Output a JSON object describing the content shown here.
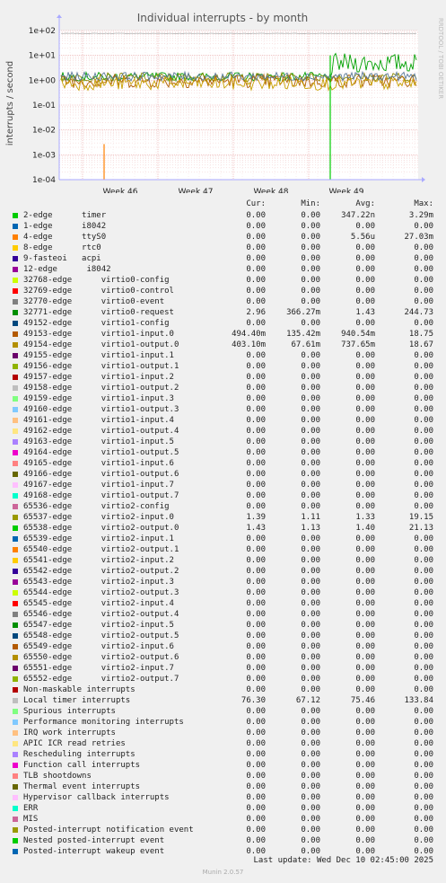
{
  "chart_data": {
    "type": "line",
    "title": "Individual interrupts - by month",
    "ylabel": "interrupts / second",
    "side_label": "RRDTOOL / TOBI OETIKER",
    "yscale": "log",
    "ylim": [
      0.0001,
      100
    ],
    "y_ticks": [
      "1e+02",
      "1e+01",
      "1e+00",
      "1e-01",
      "1e-02",
      "1e-03",
      "1e-04"
    ],
    "x_ticks": [
      "Week 46",
      "Week 47",
      "Week 48",
      "Week 49"
    ],
    "grid": true,
    "series": [
      {
        "name": "Local timer interrupts",
        "color": "#b8b8b8",
        "level": 76.3
      },
      {
        "name": "65538-edge virtio2-output.0",
        "color": "#00a000",
        "level": 1.4
      },
      {
        "name": "65537-edge virtio2-input.0",
        "color": "#8a8a00",
        "level": 1.33
      },
      {
        "name": "49153-edge virtio1-input.0",
        "color": "#b06000",
        "level": 0.94
      },
      {
        "name": "49154-edge virtio1-output.0",
        "color": "#c8a000",
        "level": 0.74
      },
      {
        "name": "32771-edge virtio0-request",
        "color": "#5a7a9a",
        "level": 1.43
      }
    ],
    "spikes": [
      {
        "series": "4-edge ttyS0",
        "x": "Week 46",
        "value": 0.0027
      },
      {
        "series": "65538-edge virtio2-output.0",
        "x": "Week 49",
        "value": 10
      }
    ]
  },
  "legend": {
    "headers": {
      "cur": "Cur:",
      "min": "Min:",
      "avg": "Avg:",
      "max": "Max:"
    },
    "rows": [
      {
        "color": "#00cc00",
        "label": "2-edge      timer",
        "cur": "0.00",
        "min": "0.00",
        "avg": "347.22n",
        "max": "3.29m"
      },
      {
        "color": "#0066b3",
        "label": "1-edge      i8042",
        "cur": "0.00",
        "min": "0.00",
        "avg": "0.00",
        "max": "0.00"
      },
      {
        "color": "#ff8000",
        "label": "4-edge      ttyS0",
        "cur": "0.00",
        "min": "0.00",
        "avg": "5.56u",
        "max": "27.03m"
      },
      {
        "color": "#ffcc00",
        "label": "8-edge      rtc0",
        "cur": "0.00",
        "min": "0.00",
        "avg": "0.00",
        "max": "0.00"
      },
      {
        "color": "#330099",
        "label": "9-fasteoi   acpi",
        "cur": "0.00",
        "min": "0.00",
        "avg": "0.00",
        "max": "0.00"
      },
      {
        "color": "#990099",
        "label": "12-edge      i8042",
        "cur": "0.00",
        "min": "0.00",
        "avg": "0.00",
        "max": "0.00"
      },
      {
        "color": "#ccff00",
        "label": "32768-edge      virtio0-config",
        "cur": "0.00",
        "min": "0.00",
        "avg": "0.00",
        "max": "0.00"
      },
      {
        "color": "#ff0000",
        "label": "32769-edge      virtio0-control",
        "cur": "0.00",
        "min": "0.00",
        "avg": "0.00",
        "max": "0.00"
      },
      {
        "color": "#808080",
        "label": "32770-edge      virtio0-event",
        "cur": "0.00",
        "min": "0.00",
        "avg": "0.00",
        "max": "0.00"
      },
      {
        "color": "#008f00",
        "label": "32771-edge      virtio0-request",
        "cur": "2.96",
        "min": "366.27m",
        "avg": "1.43",
        "max": "244.73"
      },
      {
        "color": "#00487d",
        "label": "49152-edge      virtio1-config",
        "cur": "0.00",
        "min": "0.00",
        "avg": "0.00",
        "max": "0.00"
      },
      {
        "color": "#b35a00",
        "label": "49153-edge      virtio1-input.0",
        "cur": "494.40m",
        "min": "135.42m",
        "avg": "940.54m",
        "max": "18.75"
      },
      {
        "color": "#b38f00",
        "label": "49154-edge      virtio1-output.0",
        "cur": "403.10m",
        "min": "67.61m",
        "avg": "737.65m",
        "max": "18.67"
      },
      {
        "color": "#6b006b",
        "label": "49155-edge      virtio1-input.1",
        "cur": "0.00",
        "min": "0.00",
        "avg": "0.00",
        "max": "0.00"
      },
      {
        "color": "#8fb300",
        "label": "49156-edge      virtio1-output.1",
        "cur": "0.00",
        "min": "0.00",
        "avg": "0.00",
        "max": "0.00"
      },
      {
        "color": "#b30000",
        "label": "49157-edge      virtio1-input.2",
        "cur": "0.00",
        "min": "0.00",
        "avg": "0.00",
        "max": "0.00"
      },
      {
        "color": "#bebebe",
        "label": "49158-edge      virtio1-output.2",
        "cur": "0.00",
        "min": "0.00",
        "avg": "0.00",
        "max": "0.00"
      },
      {
        "color": "#80ff80",
        "label": "49159-edge      virtio1-input.3",
        "cur": "0.00",
        "min": "0.00",
        "avg": "0.00",
        "max": "0.00"
      },
      {
        "color": "#80c9ff",
        "label": "49160-edge      virtio1-output.3",
        "cur": "0.00",
        "min": "0.00",
        "avg": "0.00",
        "max": "0.00"
      },
      {
        "color": "#ffc080",
        "label": "49161-edge      virtio1-input.4",
        "cur": "0.00",
        "min": "0.00",
        "avg": "0.00",
        "max": "0.00"
      },
      {
        "color": "#ffe680",
        "label": "49162-edge      virtio1-output.4",
        "cur": "0.00",
        "min": "0.00",
        "avg": "0.00",
        "max": "0.00"
      },
      {
        "color": "#aa80ff",
        "label": "49163-edge      virtio1-input.5",
        "cur": "0.00",
        "min": "0.00",
        "avg": "0.00",
        "max": "0.00"
      },
      {
        "color": "#ee00cc",
        "label": "49164-edge      virtio1-output.5",
        "cur": "0.00",
        "min": "0.00",
        "avg": "0.00",
        "max": "0.00"
      },
      {
        "color": "#ff8080",
        "label": "49165-edge      virtio1-input.6",
        "cur": "0.00",
        "min": "0.00",
        "avg": "0.00",
        "max": "0.00"
      },
      {
        "color": "#666600",
        "label": "49166-edge      virtio1-output.6",
        "cur": "0.00",
        "min": "0.00",
        "avg": "0.00",
        "max": "0.00"
      },
      {
        "color": "#ffbfff",
        "label": "49167-edge      virtio1-input.7",
        "cur": "0.00",
        "min": "0.00",
        "avg": "0.00",
        "max": "0.00"
      },
      {
        "color": "#00ffcc",
        "label": "49168-edge      virtio1-output.7",
        "cur": "0.00",
        "min": "0.00",
        "avg": "0.00",
        "max": "0.00"
      },
      {
        "color": "#cc6699",
        "label": "65536-edge      virtio2-config",
        "cur": "0.00",
        "min": "0.00",
        "avg": "0.00",
        "max": "0.00"
      },
      {
        "color": "#999900",
        "label": "65537-edge      virtio2-input.0",
        "cur": "1.39",
        "min": "1.11",
        "avg": "1.33",
        "max": "19.15"
      },
      {
        "color": "#00cc00",
        "label": "65538-edge      virtio2-output.0",
        "cur": "1.43",
        "min": "1.13",
        "avg": "1.40",
        "max": "21.13"
      },
      {
        "color": "#0066b3",
        "label": "65539-edge      virtio2-input.1",
        "cur": "0.00",
        "min": "0.00",
        "avg": "0.00",
        "max": "0.00"
      },
      {
        "color": "#ff8000",
        "label": "65540-edge      virtio2-output.1",
        "cur": "0.00",
        "min": "0.00",
        "avg": "0.00",
        "max": "0.00"
      },
      {
        "color": "#ffcc00",
        "label": "65541-edge      virtio2-input.2",
        "cur": "0.00",
        "min": "0.00",
        "avg": "0.00",
        "max": "0.00"
      },
      {
        "color": "#330099",
        "label": "65542-edge      virtio2-output.2",
        "cur": "0.00",
        "min": "0.00",
        "avg": "0.00",
        "max": "0.00"
      },
      {
        "color": "#990099",
        "label": "65543-edge      virtio2-input.3",
        "cur": "0.00",
        "min": "0.00",
        "avg": "0.00",
        "max": "0.00"
      },
      {
        "color": "#ccff00",
        "label": "65544-edge      virtio2-output.3",
        "cur": "0.00",
        "min": "0.00",
        "avg": "0.00",
        "max": "0.00"
      },
      {
        "color": "#ff0000",
        "label": "65545-edge      virtio2-input.4",
        "cur": "0.00",
        "min": "0.00",
        "avg": "0.00",
        "max": "0.00"
      },
      {
        "color": "#808080",
        "label": "65546-edge      virtio2-output.4",
        "cur": "0.00",
        "min": "0.00",
        "avg": "0.00",
        "max": "0.00"
      },
      {
        "color": "#008f00",
        "label": "65547-edge      virtio2-input.5",
        "cur": "0.00",
        "min": "0.00",
        "avg": "0.00",
        "max": "0.00"
      },
      {
        "color": "#00487d",
        "label": "65548-edge      virtio2-output.5",
        "cur": "0.00",
        "min": "0.00",
        "avg": "0.00",
        "max": "0.00"
      },
      {
        "color": "#b35a00",
        "label": "65549-edge      virtio2-input.6",
        "cur": "0.00",
        "min": "0.00",
        "avg": "0.00",
        "max": "0.00"
      },
      {
        "color": "#b38f00",
        "label": "65550-edge      virtio2-output.6",
        "cur": "0.00",
        "min": "0.00",
        "avg": "0.00",
        "max": "0.00"
      },
      {
        "color": "#6b006b",
        "label": "65551-edge      virtio2-input.7",
        "cur": "0.00",
        "min": "0.00",
        "avg": "0.00",
        "max": "0.00"
      },
      {
        "color": "#8fb300",
        "label": "65552-edge      virtio2-output.7",
        "cur": "0.00",
        "min": "0.00",
        "avg": "0.00",
        "max": "0.00"
      },
      {
        "color": "#b30000",
        "label": "Non-maskable interrupts",
        "cur": "0.00",
        "min": "0.00",
        "avg": "0.00",
        "max": "0.00"
      },
      {
        "color": "#bebebe",
        "label": "Local timer interrupts",
        "cur": "76.30",
        "min": "67.12",
        "avg": "75.46",
        "max": "133.84"
      },
      {
        "color": "#80ff80",
        "label": "Spurious interrupts",
        "cur": "0.00",
        "min": "0.00",
        "avg": "0.00",
        "max": "0.00"
      },
      {
        "color": "#80c9ff",
        "label": "Performance monitoring interrupts",
        "cur": "0.00",
        "min": "0.00",
        "avg": "0.00",
        "max": "0.00"
      },
      {
        "color": "#ffc080",
        "label": "IRQ work interrupts",
        "cur": "0.00",
        "min": "0.00",
        "avg": "0.00",
        "max": "0.00"
      },
      {
        "color": "#ffe680",
        "label": "APIC ICR read retries",
        "cur": "0.00",
        "min": "0.00",
        "avg": "0.00",
        "max": "0.00"
      },
      {
        "color": "#aa80ff",
        "label": "Rescheduling interrupts",
        "cur": "0.00",
        "min": "0.00",
        "avg": "0.00",
        "max": "0.00"
      },
      {
        "color": "#ee00cc",
        "label": "Function call interrupts",
        "cur": "0.00",
        "min": "0.00",
        "avg": "0.00",
        "max": "0.00"
      },
      {
        "color": "#ff8080",
        "label": "TLB shootdowns",
        "cur": "0.00",
        "min": "0.00",
        "avg": "0.00",
        "max": "0.00"
      },
      {
        "color": "#666600",
        "label": "Thermal event interrupts",
        "cur": "0.00",
        "min": "0.00",
        "avg": "0.00",
        "max": "0.00"
      },
      {
        "color": "#ffbfff",
        "label": "Hypervisor callback interrupts",
        "cur": "0.00",
        "min": "0.00",
        "avg": "0.00",
        "max": "0.00"
      },
      {
        "color": "#00ffcc",
        "label": "ERR",
        "cur": "0.00",
        "min": "0.00",
        "avg": "0.00",
        "max": "0.00"
      },
      {
        "color": "#cc6699",
        "label": "MIS",
        "cur": "0.00",
        "min": "0.00",
        "avg": "0.00",
        "max": "0.00"
      },
      {
        "color": "#999900",
        "label": "Posted-interrupt notification event",
        "cur": "0.00",
        "min": "0.00",
        "avg": "0.00",
        "max": "0.00"
      },
      {
        "color": "#00cc00",
        "label": "Nested posted-interrupt event",
        "cur": "0.00",
        "min": "0.00",
        "avg": "0.00",
        "max": "0.00"
      },
      {
        "color": "#0066b3",
        "label": "Posted-interrupt wakeup event",
        "cur": "0.00",
        "min": "0.00",
        "avg": "0.00",
        "max": "0.00"
      }
    ]
  },
  "footer": {
    "last_update": "Last update: Wed Dec 10 02:45:00 2025",
    "version": "Munin 2.0.57"
  }
}
